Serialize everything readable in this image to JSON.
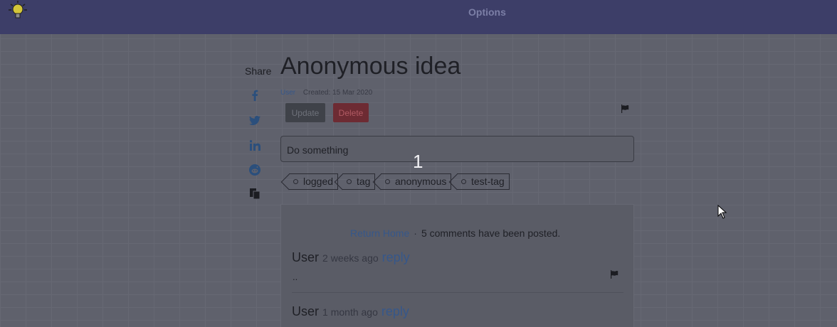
{
  "topbar": {
    "options_label": "Options"
  },
  "share": {
    "label": "Share",
    "icons": [
      "facebook-icon",
      "twitter-icon",
      "linkedin-icon",
      "reddit-icon",
      "copy-icon"
    ]
  },
  "idea": {
    "title": "Anonymous idea",
    "author": "User",
    "created": "Created: 15 Mar 2020",
    "update_label": "Update",
    "delete_label": "Delete",
    "description": "Do something",
    "count": "1",
    "tags": [
      "logged",
      "tag",
      "anonymous",
      "test-tag"
    ]
  },
  "comments": {
    "return_home": "Return Home",
    "separator": "·",
    "summary": "5 comments have been posted.",
    "items": [
      {
        "user": "User",
        "time": "2 weeks ago",
        "reply": "reply",
        "body": ".."
      },
      {
        "user": "User",
        "time": "1 month ago",
        "reply": "reply",
        "body": ""
      }
    ]
  },
  "colors": {
    "topbar": "#3d3e68",
    "accent": "#36578a",
    "delete": "#6d2b33"
  }
}
